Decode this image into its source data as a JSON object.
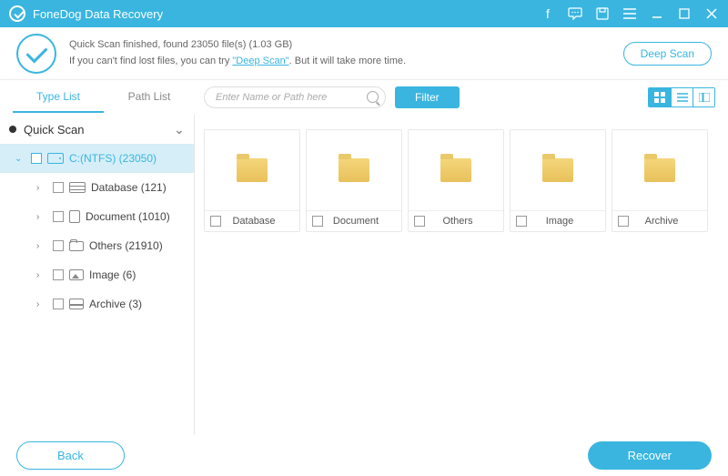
{
  "titlebar": {
    "app_name": "FoneDog Data Recovery"
  },
  "status": {
    "line1_pre": "Quick Scan finished, found ",
    "file_count": "23050",
    "line1_mid": " file(s) (",
    "total_size": "1.03 GB",
    "line1_post": ")",
    "line2_pre": "If you can't find lost files, you can try ",
    "deep_link": "\"Deep Scan\"",
    "line2_post": ". But it will take more time."
  },
  "buttons": {
    "deep_scan": "Deep Scan",
    "filter": "Filter",
    "back": "Back",
    "recover": "Recover"
  },
  "tabs": {
    "type_list": "Type List",
    "path_list": "Path List"
  },
  "search": {
    "placeholder": "Enter Name or Path here"
  },
  "tree": {
    "root": "Quick Scan",
    "drive": "C:(NTFS) (23050)",
    "items": [
      {
        "label": "Database (121)"
      },
      {
        "label": "Document (1010)"
      },
      {
        "label": "Others (21910)"
      },
      {
        "label": "Image (6)"
      },
      {
        "label": "Archive (3)"
      }
    ]
  },
  "folders": [
    {
      "name": "Database"
    },
    {
      "name": "Document"
    },
    {
      "name": "Others"
    },
    {
      "name": "Image"
    },
    {
      "name": "Archive"
    }
  ]
}
